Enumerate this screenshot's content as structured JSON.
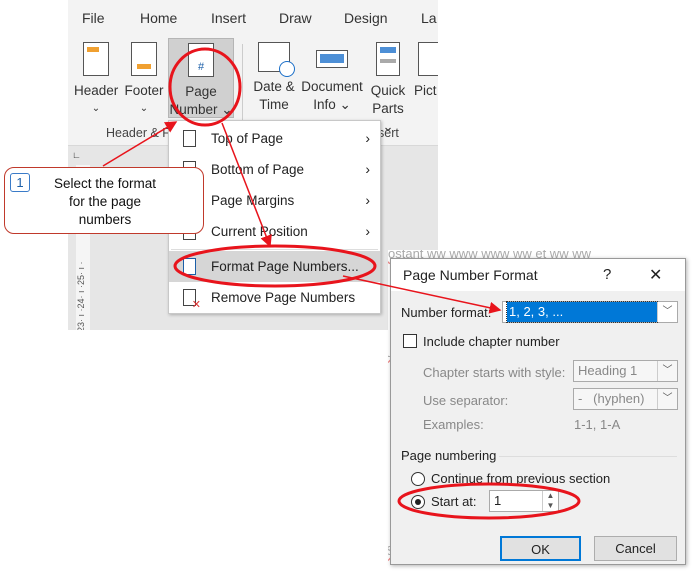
{
  "ribbon": {
    "tabs": [
      "File",
      "Home",
      "Insert",
      "Draw",
      "Design",
      "La"
    ],
    "buttons": {
      "header": "Header",
      "footer": "Footer",
      "page_number_1": "Page",
      "page_number_2": "Number",
      "date_time_1": "Date &",
      "date_time_2": "Time",
      "doc_info_1": "Document",
      "doc_info_2": "Info",
      "quick_parts_1": "Quick",
      "quick_parts_2": "Parts",
      "pictures": "Pict"
    },
    "groups": {
      "header_footer": "Header & F",
      "insert": "sert"
    }
  },
  "ruler": {
    "marks": "·23· ı ·24· ı ·25· ı ·"
  },
  "menu": {
    "items": [
      {
        "label": "Top of Page",
        "submenu": true
      },
      {
        "label": "Bottom of Page",
        "submenu": true
      },
      {
        "label": "Page Margins",
        "submenu": true
      },
      {
        "label": "Current Position",
        "submenu": true
      },
      {
        "label": "Format Page Numbers...",
        "highlighted": true
      },
      {
        "label": "Remove Page Numbers"
      }
    ]
  },
  "callout": {
    "number": "1",
    "text": "Select the format for the page numbers"
  },
  "dialog": {
    "title": "Page Number Format",
    "help": "?",
    "close": "✕",
    "number_format_label": "Number format:",
    "number_format_value": "1, 2, 3, ...",
    "include_chapter": "Include chapter number",
    "include_chapter_checked": false,
    "chapter_style_label": "Chapter starts with style:",
    "chapter_style_value": "Heading 1",
    "separator_label": "Use separator:",
    "separator_value": "-   (hyphen)",
    "examples_label": "Examples:",
    "examples_value": "1-1, 1-A",
    "page_numbering": "Page numbering",
    "continue_label": "Continue from previous section",
    "start_at_label": "Start at:",
    "start_at_value": "1",
    "selected_option": "start_at",
    "ok": "OK",
    "cancel": "Cancel"
  },
  "colors": {
    "annotation": "#e8141c",
    "selection": "#0078d7"
  }
}
